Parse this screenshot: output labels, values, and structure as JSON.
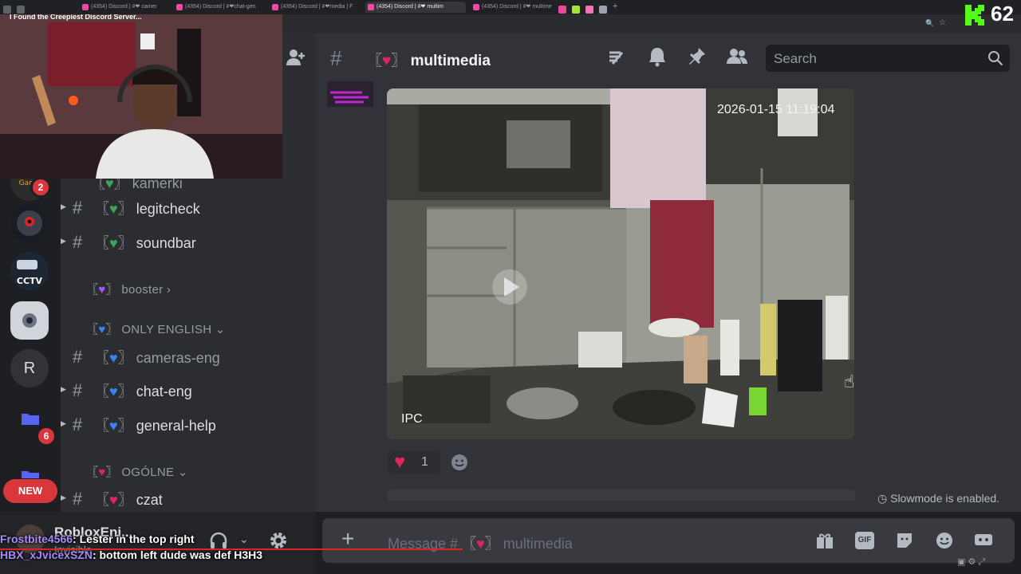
{
  "browser": {
    "stream_title": "I Found the Creepiest Discord Server...",
    "tabs": [
      {
        "label": "(4354) Discord | #❤ camer",
        "active": false
      },
      {
        "label": "(4354) Discord | #❤chat-gen",
        "active": false
      },
      {
        "label": "(4354) Discord | #❤media | F",
        "active": false
      },
      {
        "label": "(4354) Discord | #❤ multim",
        "active": true
      },
      {
        "label": "(4354) Discord | #❤ multime",
        "active": false
      }
    ]
  },
  "stream_overlay": {
    "kick_count": "62"
  },
  "servers": {
    "badges": [
      "2",
      "6"
    ],
    "letter_server": "R",
    "new_label": "NEW"
  },
  "sidebar": {
    "partial_channel": "kamerki",
    "categories": [
      {
        "label": "booster",
        "emoji_color": "#a855f7"
      },
      {
        "label": "ONLY ENGLISH",
        "emoji_color": "#3b82f6"
      },
      {
        "label": "OGÓLNE",
        "emoji_color": "#e0245e"
      }
    ],
    "channels": [
      {
        "name": "legitcheck",
        "emoji_color": "#3ba55c"
      },
      {
        "name": "soundbar",
        "emoji_color": "#3ba55c"
      },
      {
        "name": "cameras-eng",
        "emoji_color": "#3b82f6"
      },
      {
        "name": "chat-eng",
        "emoji_color": "#3b82f6"
      },
      {
        "name": "general-help",
        "emoji_color": "#3b82f6"
      },
      {
        "name": "czat",
        "emoji_color": "#e0245e"
      }
    ]
  },
  "header": {
    "channel_name": "multimedia",
    "search_placeholder": "Search"
  },
  "message": {
    "video_timestamp": "2026-01-15 11:19:04",
    "video_watermark": "IPC",
    "reaction_count": "1"
  },
  "composer": {
    "placeholder_prefix": "Message #",
    "channel": "multimedia",
    "slowmode_text": "Slowmode is enabled."
  },
  "user_panel": {
    "username": "RobloxEni...",
    "status": "Invisible"
  },
  "live_chat": [
    {
      "user": "Frostbite4566",
      "user_color": "#a78bfa",
      "text": ": Lester in the top right"
    },
    {
      "user": "HBX_xJvicexSZN",
      "user_color": "#a78bfa",
      "text": ": bottom left dude was def H3H3"
    }
  ]
}
